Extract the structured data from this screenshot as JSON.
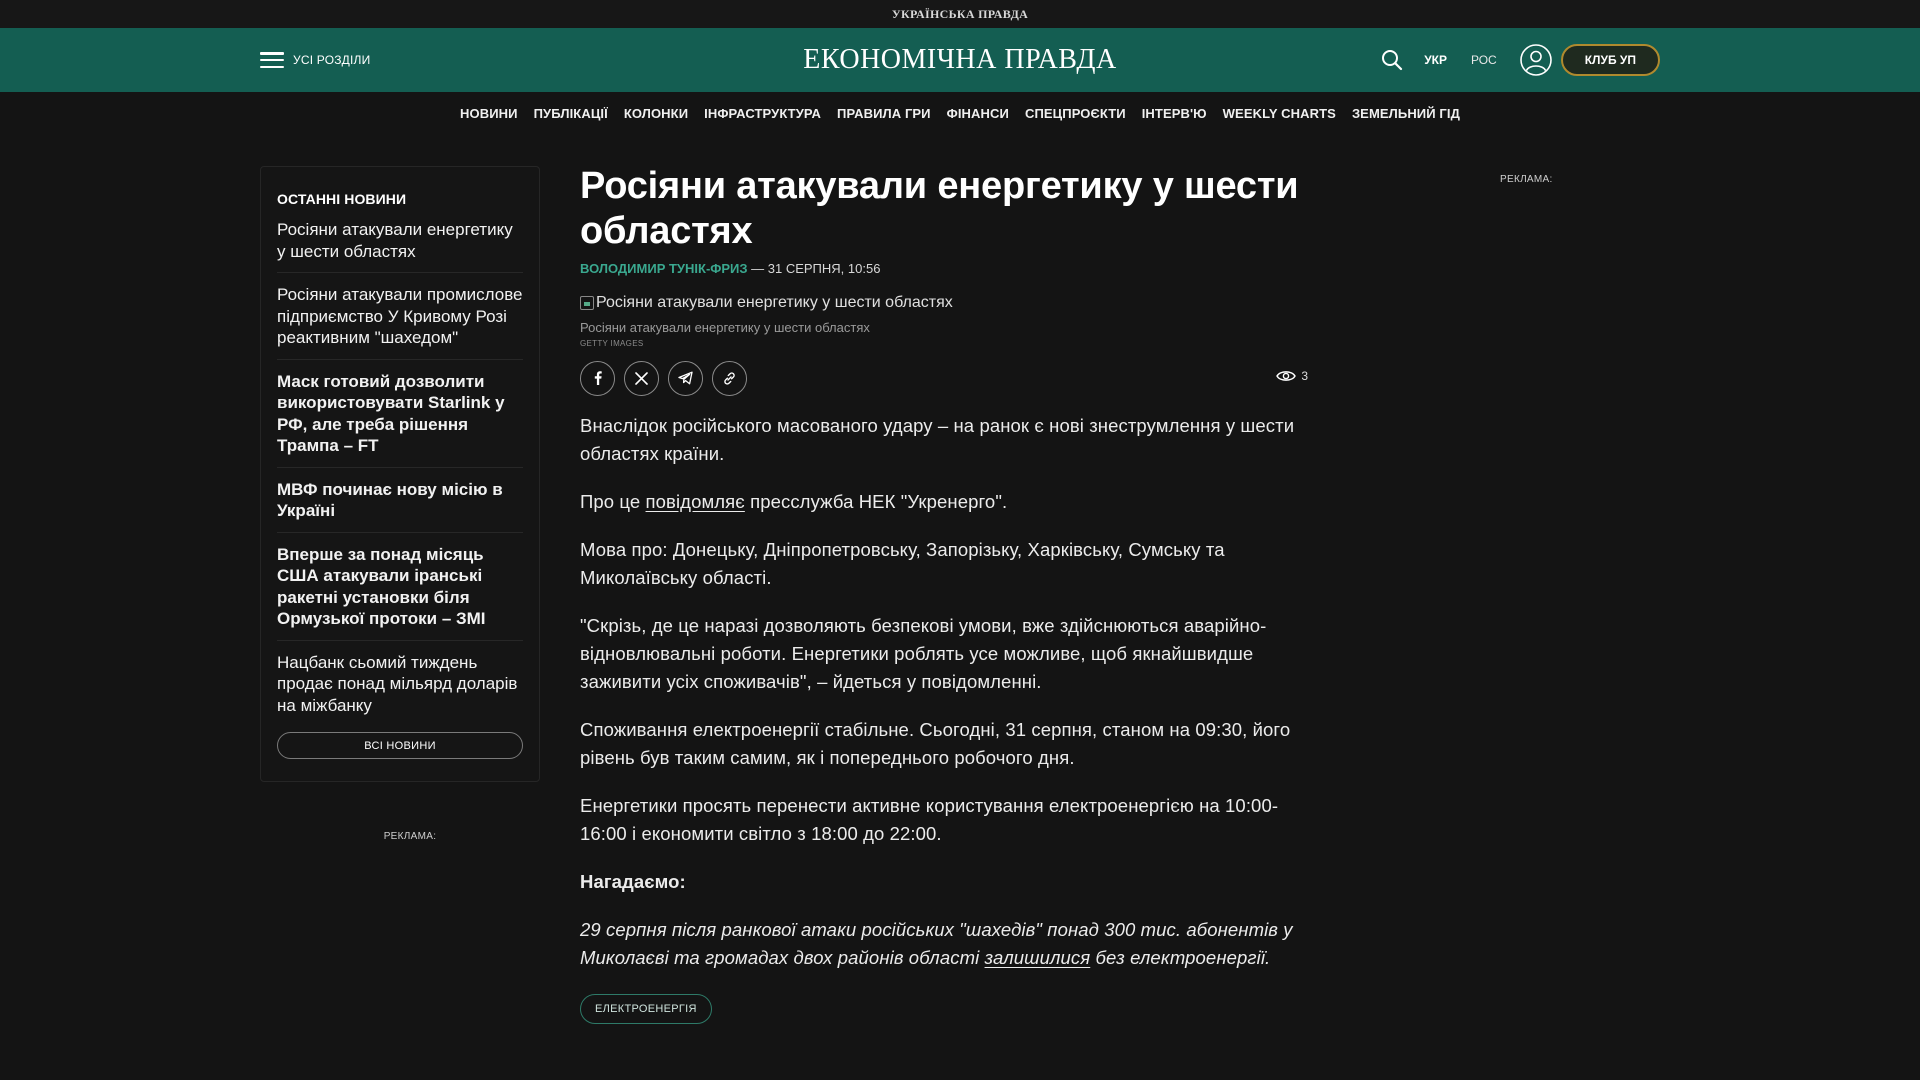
{
  "top_strip": {
    "site": "УКРАЇНСЬКА ПРАВДА"
  },
  "header": {
    "menu_label": "УСІ РОЗДІЛИ",
    "logo": "ЕКОНОМІЧНА ПРАВДА",
    "lang_ukr": "УКР",
    "lang_ros": "РОС",
    "club_label": "КЛУБ УП"
  },
  "nav": {
    "items": [
      "НОВИНИ",
      "ПУБЛІКАЦІЇ",
      "КОЛОНКИ",
      "ІНФРАСТРУКТУРА",
      "ПРАВИЛА ГРИ",
      "ФІНАНСИ",
      "СПЕЦПРОЄКТИ",
      "ІНТЕРВ'Ю",
      "WEEKLY CHARTS",
      "ЗЕМЕЛЬНИЙ ГІД"
    ]
  },
  "sidebar": {
    "title": "ОСТАННІ НОВИНИ",
    "items": [
      {
        "text": "Росіяни атакували енергетику у шести областях"
      },
      {
        "text": "Росіяни атакували промислове підприємство У Кривому Розі реактивним \"шахедом\""
      },
      {
        "text": "Маск готовий дозволити використовувати Starlink у РФ, але треба рішення Трампа – FT"
      },
      {
        "text": "МВФ починає нову місію в Україні"
      },
      {
        "text": "Вперше за понад місяць США атакували іранські ракетні установки біля Ормузької протоки – ЗМІ"
      },
      {
        "text": "Нацбанк сьомий тиждень продає понад мільярд доларів на міжбанку"
      }
    ],
    "all_news": "ВСІ НОВИНИ",
    "ad_label": "РЕКЛАМА:"
  },
  "article": {
    "title": "Росіяни атакували енергетику у шести областях",
    "author": "ВОЛОДИМИР ТУНІК-ФРИЗ",
    "date": " — 31 СЕРПНЯ, 10:56",
    "image_alt": "Росіяни атакували енергетику у шести областях",
    "caption": "Росіяни атакували енергетику у шести областях",
    "credit": "GETTY IMAGES",
    "views": "3",
    "paragraphs": {
      "p1": "Внаслідок російського масованого удару – на ранок є нові знеструмлення у шести областях країни.",
      "p2_before": "Про це ",
      "p2_link": "повідомляє",
      "p2_after": " пресслужба НЕК \"Укренерго\".",
      "p3": "Мова про: Донецьку, Дніпропетровську, Запорізьку, Харківську, Сумську та Миколаївську області.",
      "p4": "\"Скрізь, де це наразі дозволяють безпекові умови, вже здійснюються аварійно-відновлювальні роботи. Енергетики роблять усе можливе, щоб якнайшвидше заживити усіх споживачів\", – йдеться у повідомленні.",
      "p5": "Споживання електроенергії стабільне. Сьогодні, 31 серпня, станом на 09:30, його рівень був таким самим, як і попереднього робочого дня.",
      "p6": "Енергетики просять перенести активне користування електроенергією на 10:00-16:00 і економити світло з 18:00 до 22:00.",
      "p7": "Нагадаємо:",
      "p8_before": "29 серпня після ранкової атаки російських \"шахедів\" понад 300 тис. абонентів у Миколаєві та громадах двох районів області ",
      "p8_link": "залишилися",
      "p8_after": " без електроенергії."
    },
    "tag": "ЕЛЕКТРОЕНЕРГІЯ"
  },
  "right_ad_label": "РЕКЛАМА:",
  "colors": {
    "header_bg": "#145e52",
    "accent": "#3aa88f",
    "club_border": "#b08a2e",
    "page_bg": "#141414"
  }
}
